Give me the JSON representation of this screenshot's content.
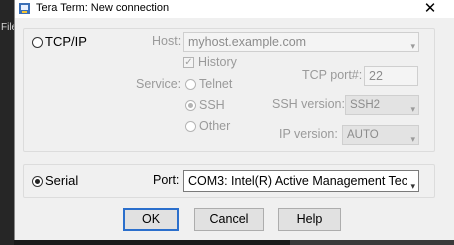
{
  "background": {
    "menu_label": "File"
  },
  "window": {
    "title": "Tera Term: New connection",
    "close_glyph": "✕"
  },
  "tcpip": {
    "label": "TCP/IP",
    "selected": false,
    "host_label": "Host:",
    "host_value": "myhost.example.com",
    "history_label": "History",
    "history_checked": true,
    "service_label": "Service:",
    "services": [
      "Telnet",
      "SSH",
      "Other"
    ],
    "selected_service": "SSH",
    "tcp_port_label": "TCP port#:",
    "tcp_port_value": "22",
    "ssh_version_label": "SSH version:",
    "ssh_version_value": "SSH2",
    "ip_version_label": "IP version:",
    "ip_version_value": "AUTO"
  },
  "serial": {
    "label": "Serial",
    "selected": true,
    "port_label": "Port:",
    "port_value": "COM3: Intel(R) Active Management Tec"
  },
  "buttons": {
    "ok": "OK",
    "cancel": "Cancel",
    "help": "Help"
  },
  "icons": {
    "app": "tera-term-icon",
    "close": "close-icon",
    "dropdown": "chevron-down-icon"
  },
  "colors": {
    "default_button_border": "#2b6fcc",
    "disabled_text": "#9a9a9a"
  }
}
